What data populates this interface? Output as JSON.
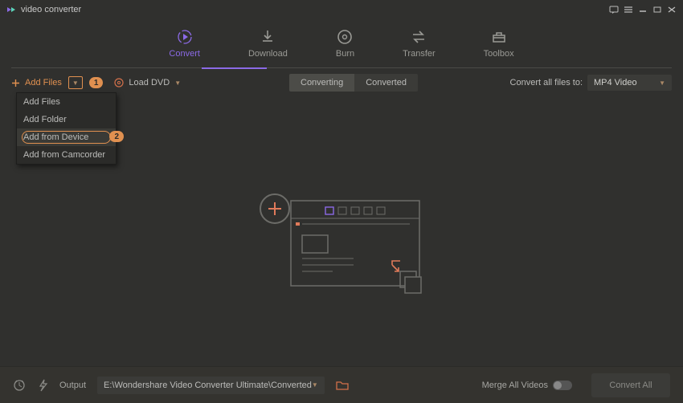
{
  "title": "video converter",
  "nav": {
    "convert": "Convert",
    "download": "Download",
    "burn": "Burn",
    "transfer": "Transfer",
    "toolbox": "Toolbox"
  },
  "toolbar": {
    "add_files": "Add Files",
    "load_dvd": "Load DVD",
    "step1": "1"
  },
  "segmented": {
    "converting": "Converting",
    "converted": "Converted"
  },
  "convert_to": {
    "label": "Convert all files to:",
    "value": "MP4 Video"
  },
  "dropdown": {
    "add_files": "Add Files",
    "add_folder": "Add Folder",
    "add_from_device": "Add from Device",
    "add_from_camcorder": "Add from Camcorder",
    "step2": "2"
  },
  "footer": {
    "output_label": "Output",
    "output_path": "E:\\Wondershare Video Converter Ultimate\\Converted",
    "merge_label": "Merge All Videos",
    "convert_all": "Convert All"
  }
}
